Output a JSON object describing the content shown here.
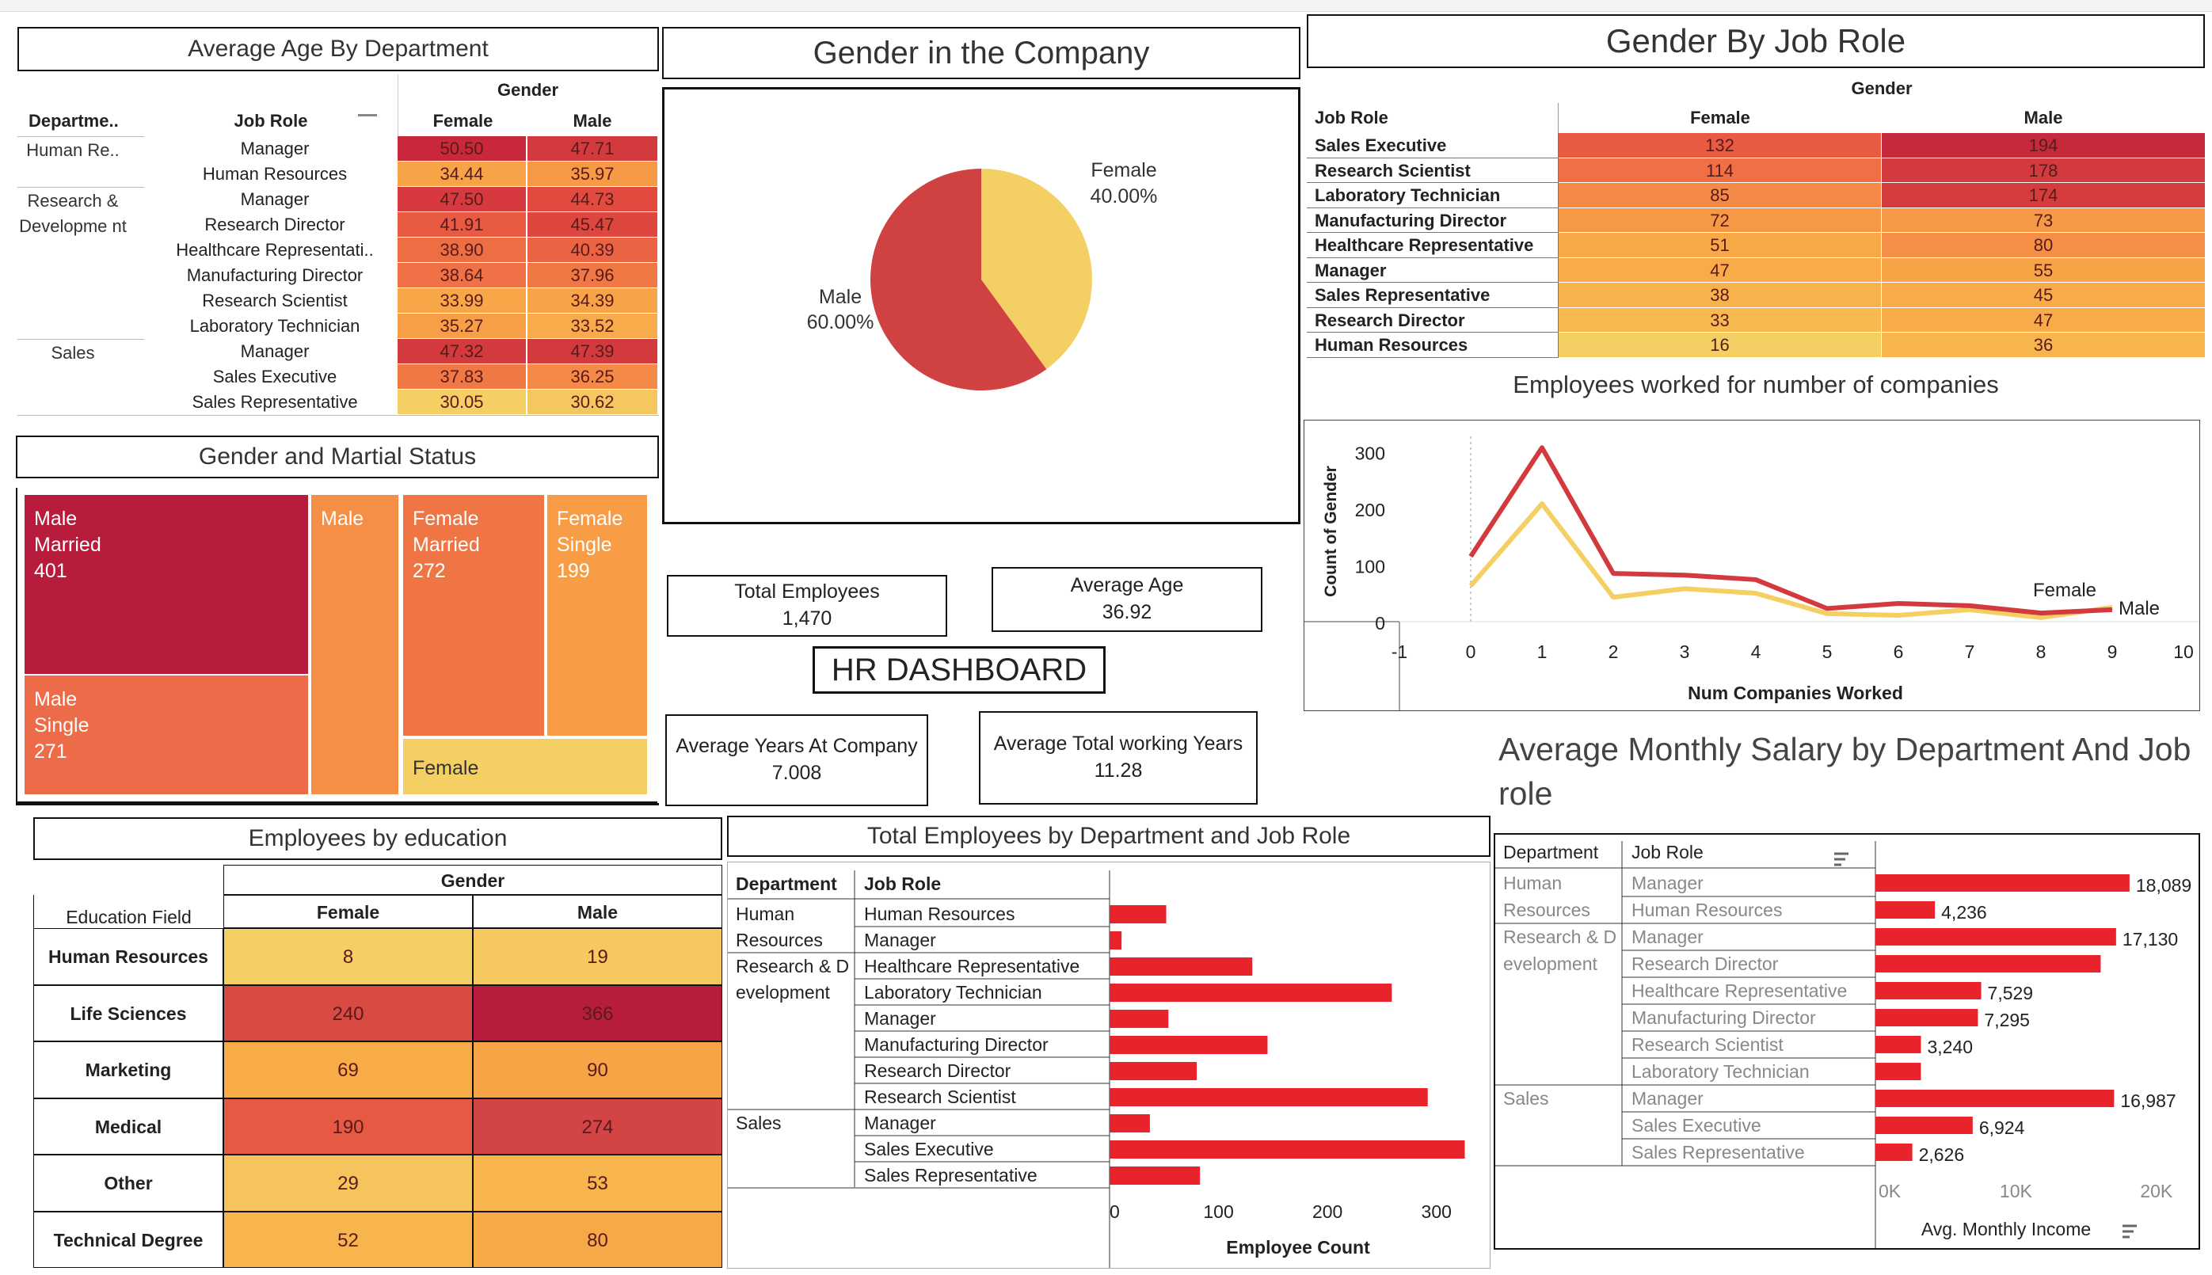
{
  "titles": {
    "avg_age": "Average Age By Department",
    "gender_company": "Gender in the Company",
    "gender_job": "Gender By Job Role",
    "gender_marital": "Gender and Martial Status",
    "employees_companies": "Employees worked for number of companies",
    "hr_dashboard": "HR DASHBOARD",
    "avg_salary": "Average Monthly Salary by Department And Job role",
    "education": "Employees by education",
    "dept_job": "Total Employees by Department and Job Role"
  },
  "kpis": {
    "total_employees": {
      "label": "Total Employees",
      "value": "1,470"
    },
    "average_age": {
      "label": "Average Age",
      "value": "36.92"
    },
    "avg_years_company": {
      "label": "Average Years At Company",
      "value": "7.008"
    },
    "avg_total_working": {
      "label": "Average Total working Years",
      "value": "11.28"
    }
  },
  "avg_age_table": {
    "gender_header": "Gender",
    "col_department": "Departme..",
    "col_job_role": "Job Role",
    "col_female": "Female",
    "col_male": "Male",
    "groups": [
      {
        "department": "Human Re..",
        "rows": [
          {
            "job": "Manager",
            "female": "50.50",
            "male": "47.71",
            "fc": "#c8283a",
            "mc": "#d23a3e"
          },
          {
            "job": "Human Resources",
            "female": "34.44",
            "male": "35.97",
            "fc": "#f7a348",
            "mc": "#f79a45"
          }
        ]
      },
      {
        "department": "Research & Developme nt",
        "rows": [
          {
            "job": "Manager",
            "female": "47.50",
            "male": "44.73",
            "fc": "#d63a3e",
            "mc": "#e24a40"
          },
          {
            "job": "Research Director",
            "female": "41.91",
            "male": "45.47",
            "fc": "#e85b42",
            "mc": "#de4640"
          },
          {
            "job": "Healthcare Representati..",
            "female": "38.90",
            "male": "40.39",
            "fc": "#ee6e44",
            "mc": "#ea6343"
          },
          {
            "job": "Manufacturing Director",
            "female": "38.64",
            "male": "37.96",
            "fc": "#ef7145",
            "mc": "#f07845"
          },
          {
            "job": "Research Scientist",
            "female": "33.99",
            "male": "34.39",
            "fc": "#f8a748",
            "mc": "#f7a348"
          },
          {
            "job": "Laboratory Technician",
            "female": "35.27",
            "male": "33.52",
            "fc": "#f79f46",
            "mc": "#f8ab4a"
          }
        ]
      },
      {
        "department": "Sales",
        "rows": [
          {
            "job": "Manager",
            "female": "47.32",
            "male": "47.39",
            "fc": "#d23a3e",
            "mc": "#d23a3e"
          },
          {
            "job": "Sales Executive",
            "female": "37.83",
            "male": "36.25",
            "fc": "#f07845",
            "mc": "#f58a46"
          },
          {
            "job": "Sales Representative",
            "female": "30.05",
            "male": "30.62",
            "fc": "#f5cf63",
            "mc": "#f4c75f"
          }
        ]
      }
    ]
  },
  "gender_job_table": {
    "gender_header": "Gender",
    "col_job_role": "Job Role",
    "col_female": "Female",
    "col_male": "Male",
    "rows": [
      {
        "job": "Sales Executive",
        "female": "132",
        "male": "194",
        "fc": "#e85a42",
        "mc": "#c52a3c"
      },
      {
        "job": "Research Scientist",
        "female": "114",
        "male": "178",
        "fc": "#ef7045",
        "mc": "#d23a3e"
      },
      {
        "job": "Laboratory Technician",
        "female": "85",
        "male": "174",
        "fc": "#f48a46",
        "mc": "#d43c3e"
      },
      {
        "job": "Manufacturing Director",
        "female": "72",
        "male": "73",
        "fc": "#f69946",
        "mc": "#f69946"
      },
      {
        "job": "Healthcare Representative",
        "female": "51",
        "male": "80",
        "fc": "#f8a947",
        "mc": "#f58f46"
      },
      {
        "job": "Manager",
        "female": "47",
        "male": "55",
        "fc": "#f8ab48",
        "mc": "#f7a447"
      },
      {
        "job": "Sales Representative",
        "female": "38",
        "male": "45",
        "fc": "#f8b24d",
        "mc": "#f8ab48"
      },
      {
        "job": "Research Director",
        "female": "33",
        "male": "47",
        "fc": "#f7b950",
        "mc": "#f8ab48"
      },
      {
        "job": "Human Resources",
        "female": "16",
        "male": "36",
        "fc": "#f4d064",
        "mc": "#f8b44d"
      }
    ]
  },
  "pie": {
    "female_label": "Female",
    "female_pct": "40.00%",
    "male_label": "Male",
    "male_pct": "60.00%",
    "female_color": "#f4cf63",
    "male_color": "#d04242"
  },
  "treemap": {
    "cells": [
      {
        "l1": "Male",
        "l2": "Married",
        "l3": "401",
        "color": "#b71c3c"
      },
      {
        "l1": "Male",
        "l2": "Single",
        "l3": "271",
        "color": "#ec6b48"
      },
      {
        "l1": "Male",
        "l2": "",
        "l3": "",
        "color": "#f58f46"
      },
      {
        "l1": "Female",
        "l2": "Married",
        "l3": "272",
        "color": "#ef7545"
      },
      {
        "l1": "Female",
        "l2": "Single",
        "l3": "199",
        "color": "#f89d46"
      },
      {
        "l1": "Female",
        "l2": "",
        "l3": "",
        "color": "#f4cf63"
      }
    ]
  },
  "education_table": {
    "gender_header": "Gender",
    "col_field": "Education Field",
    "col_female": "Female",
    "col_male": "Male",
    "rows": [
      {
        "field": "Human Resources",
        "female": "8",
        "male": "19",
        "fc": "#f4cf63",
        "mc": "#f5c95f"
      },
      {
        "field": "Life Sciences",
        "female": "240",
        "male": "366",
        "fc": "#d94a44",
        "mc": "#b71c3c"
      },
      {
        "field": "Marketing",
        "female": "69",
        "male": "90",
        "fc": "#f8ac48",
        "mc": "#f7a447"
      },
      {
        "field": "Medical",
        "female": "190",
        "male": "274",
        "fc": "#e65a44",
        "mc": "#d34444"
      },
      {
        "field": "Other",
        "female": "29",
        "male": "53",
        "fc": "#f5c45c",
        "mc": "#f8b44d"
      },
      {
        "field": "Technical Degree",
        "female": "52",
        "male": "80",
        "fc": "#f8b44d",
        "mc": "#f7a948"
      }
    ]
  },
  "chart_data": [
    {
      "type": "line",
      "title": "Employees worked for number of companies",
      "xlabel": "Num Companies Worked",
      "ylabel": "Count of Gender",
      "x": [
        0,
        1,
        2,
        3,
        4,
        5,
        6,
        7,
        8,
        9
      ],
      "xlim": [
        -1,
        10
      ],
      "ylim": [
        0,
        330
      ],
      "xticks": [
        "-1",
        "0",
        "1",
        "2",
        "3",
        "4",
        "5",
        "6",
        "7",
        "8",
        "9",
        "10"
      ],
      "yticks": [
        "0",
        "100",
        "200",
        "300"
      ],
      "series": [
        {
          "name": "Male",
          "values": [
            118,
            310,
            88,
            85,
            77,
            26,
            35,
            31,
            18,
            24
          ],
          "color": "#d23a3e"
        },
        {
          "name": "Female",
          "values": [
            66,
            211,
            46,
            61,
            53,
            17,
            14,
            24,
            10,
            28
          ],
          "color": "#f4cf63"
        }
      ]
    },
    {
      "type": "bar",
      "title": "Total Employees by Department and Job Role",
      "col_department": "Department",
      "col_job_role": "Job Role",
      "xlabel": "Employee Count",
      "xlim": [
        0,
        330
      ],
      "xticks": [
        "0",
        "100",
        "200",
        "300"
      ],
      "groups": [
        {
          "department": "Human Resources",
          "rows": [
            {
              "job": "Human Resources",
              "value": 52
            },
            {
              "job": "Manager",
              "value": 11
            }
          ]
        },
        {
          "department": "Research & Development",
          "rows": [
            {
              "job": "Healthcare Representative",
              "value": 131
            },
            {
              "job": "Laboratory Technician",
              "value": 259
            },
            {
              "job": "Manager",
              "value": 54
            },
            {
              "job": "Manufacturing Director",
              "value": 145
            },
            {
              "job": "Research Director",
              "value": 80
            },
            {
              "job": "Research Scientist",
              "value": 292
            }
          ]
        },
        {
          "department": "Sales",
          "rows": [
            {
              "job": "Manager",
              "value": 37
            },
            {
              "job": "Sales Executive",
              "value": 326
            },
            {
              "job": "Sales Representative",
              "value": 83
            }
          ]
        }
      ]
    },
    {
      "type": "bar",
      "title": "Average Monthly Salary by Department And Job role",
      "col_department": "Department",
      "col_job_role": "Job Role",
      "xlabel": "Avg. Monthly Income",
      "xlim": [
        0,
        23000
      ],
      "xticks": [
        "0K",
        "10K",
        "20K"
      ],
      "groups": [
        {
          "department": "Human Resources",
          "rows": [
            {
              "job": "Manager",
              "value": 18089,
              "label": "18,089"
            },
            {
              "job": "Human Resources",
              "value": 4236,
              "label": "4,236"
            }
          ]
        },
        {
          "department": "Research & Development",
          "rows": [
            {
              "job": "Manager",
              "value": 17130,
              "label": "17,130"
            },
            {
              "job": "Research Director",
              "value": 16034,
              "label": ""
            },
            {
              "job": "Healthcare Representative",
              "value": 7529,
              "label": "7,529"
            },
            {
              "job": "Manufacturing Director",
              "value": 7295,
              "label": "7,295"
            },
            {
              "job": "Research Scientist",
              "value": 3240,
              "label": "3,240"
            },
            {
              "job": "Laboratory Technician",
              "value": 3237,
              "label": ""
            }
          ]
        },
        {
          "department": "Sales",
          "rows": [
            {
              "job": "Manager",
              "value": 16987,
              "label": "16,987"
            },
            {
              "job": "Sales Executive",
              "value": 6924,
              "label": "6,924"
            },
            {
              "job": "Sales Representative",
              "value": 2626,
              "label": "2,626"
            }
          ]
        }
      ]
    }
  ]
}
